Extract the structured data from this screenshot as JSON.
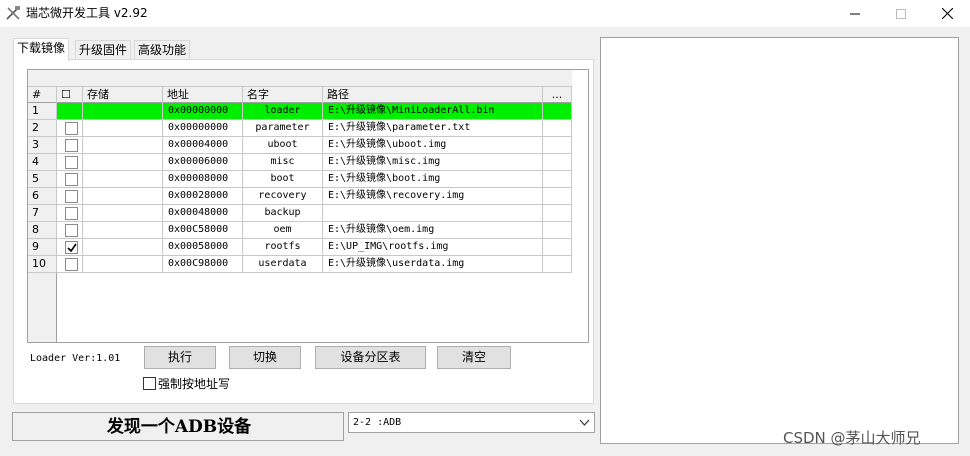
{
  "window": {
    "title": "瑞芯微开发工具 v2.92",
    "app_icon": "rockchip-tools-icon",
    "controls": [
      "minimize-icon",
      "maximize-icon",
      "close-icon"
    ]
  },
  "tabs": [
    {
      "label": "下载镜像",
      "active": true
    },
    {
      "label": "升级固件",
      "active": false
    },
    {
      "label": "高级功能",
      "active": false
    }
  ],
  "table": {
    "columns": {
      "num": "#",
      "check": "☐",
      "storage": "存储",
      "address": "地址",
      "name": "名字",
      "path": "路径",
      "more": "..."
    },
    "rows": [
      {
        "num": "1",
        "checked": false,
        "storage": "",
        "address": "0x00000000",
        "name": "loader",
        "path": "E:\\升级镜像\\MiniLoaderAll.bin",
        "selected": true
      },
      {
        "num": "2",
        "checked": false,
        "storage": "",
        "address": "0x00000000",
        "name": "parameter",
        "path": "E:\\升级镜像\\parameter.txt",
        "selected": false
      },
      {
        "num": "3",
        "checked": false,
        "storage": "",
        "address": "0x00004000",
        "name": "uboot",
        "path": "E:\\升级镜像\\uboot.img",
        "selected": false
      },
      {
        "num": "4",
        "checked": false,
        "storage": "",
        "address": "0x00006000",
        "name": "misc",
        "path": "E:\\升级镜像\\misc.img",
        "selected": false
      },
      {
        "num": "5",
        "checked": false,
        "storage": "",
        "address": "0x00008000",
        "name": "boot",
        "path": "E:\\升级镜像\\boot.img",
        "selected": false
      },
      {
        "num": "6",
        "checked": false,
        "storage": "",
        "address": "0x00028000",
        "name": "recovery",
        "path": "E:\\升级镜像\\recovery.img",
        "selected": false
      },
      {
        "num": "7",
        "checked": false,
        "storage": "",
        "address": "0x00048000",
        "name": "backup",
        "path": "",
        "selected": false
      },
      {
        "num": "8",
        "checked": false,
        "storage": "",
        "address": "0x00C58000",
        "name": "oem",
        "path": "E:\\升级镜像\\oem.img",
        "selected": false
      },
      {
        "num": "9",
        "checked": true,
        "storage": "",
        "address": "0x00058000",
        "name": "rootfs",
        "path": "E:\\UP_IMG\\rootfs.img",
        "selected": false
      },
      {
        "num": "10",
        "checked": false,
        "storage": "",
        "address": "0x00C98000",
        "name": "userdata",
        "path": "E:\\升级镜像\\userdata.img",
        "selected": false
      }
    ]
  },
  "bottom": {
    "loader_version": "Loader Ver:1.01",
    "buttons": {
      "run": "执行",
      "switch": "切换",
      "partition_table": "设备分区表",
      "clear": "清空"
    },
    "force_address_label": "强制按地址写",
    "force_address_checked": false
  },
  "status": {
    "text": "发现一个ADB设备"
  },
  "device_select": {
    "value": "2-2 :ADB"
  },
  "watermark": "CSDN @茅山大师兄",
  "colors": {
    "selected_row": "#00ee00",
    "window_bg": "#f0f0f0"
  }
}
